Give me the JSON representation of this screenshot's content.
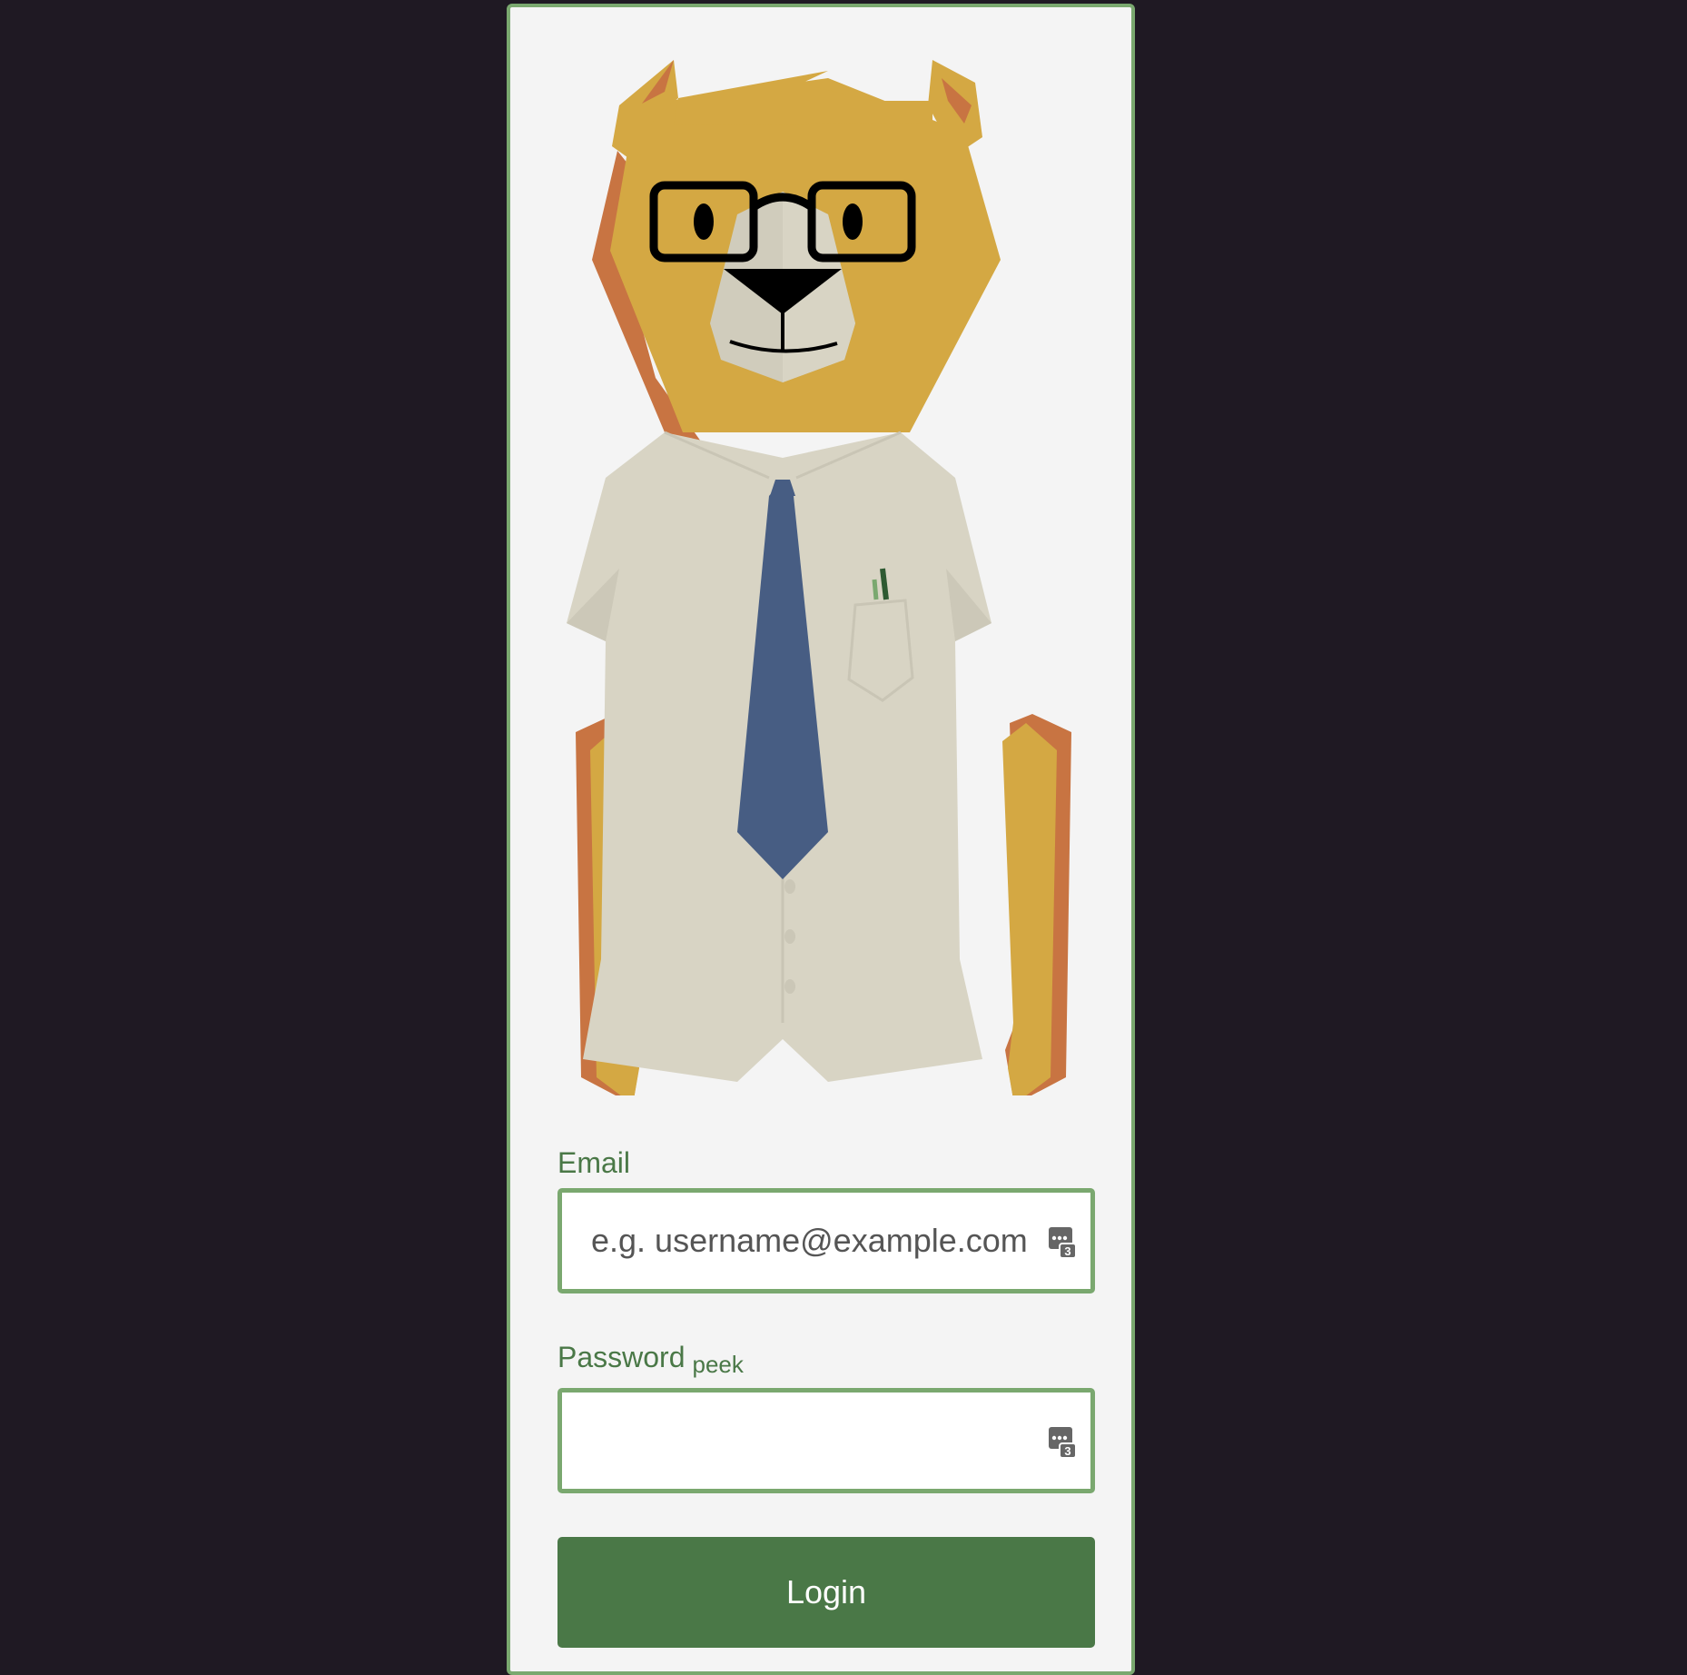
{
  "login_form": {
    "email": {
      "label": "Email",
      "placeholder": "e.g. username@example.com",
      "value": ""
    },
    "password": {
      "label": "Password",
      "peek_label": "peek",
      "value": ""
    },
    "login_label": "Login"
  },
  "icons": {
    "password_manager": "password-manager-icon",
    "password_manager_badge": "3"
  },
  "colors": {
    "page_background": "#1f1923",
    "card_background": "#f4f4f4",
    "accent_green": "#4a7847",
    "border_green": "#7aa86f",
    "bear_fur": "#d4a843",
    "bear_shadow": "#c87442",
    "shirt": "#d8d4c4",
    "tie": "#475d83"
  }
}
